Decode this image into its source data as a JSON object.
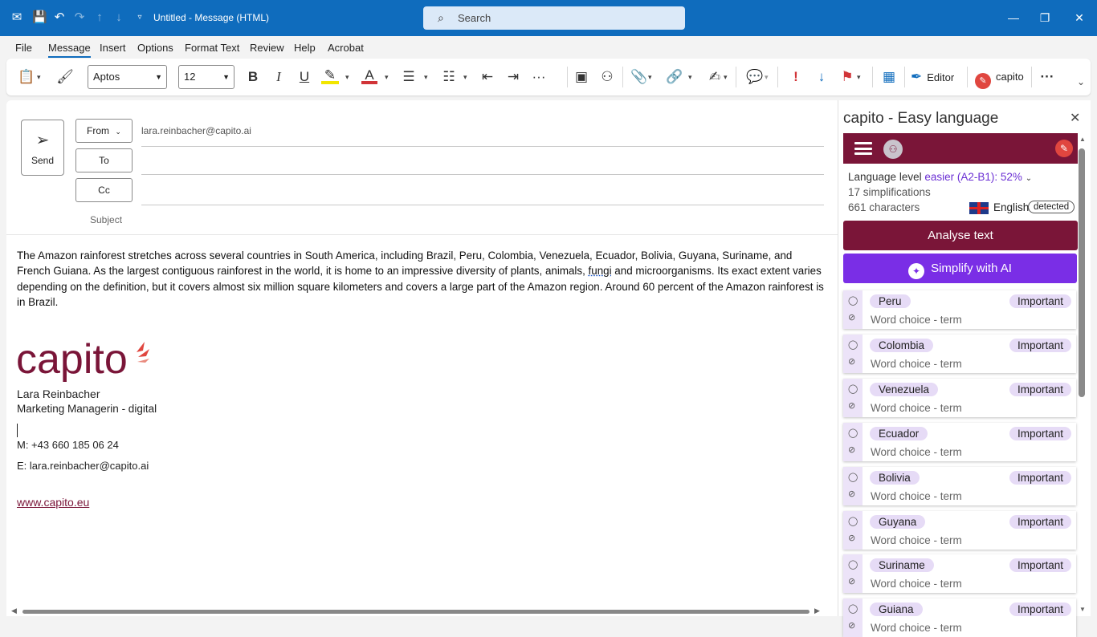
{
  "window": {
    "title": "Untitled - Message (HTML)",
    "search_placeholder": "Search"
  },
  "menu": [
    "File",
    "Message",
    "Insert",
    "Options",
    "Format Text",
    "Review",
    "Help",
    "Acrobat"
  ],
  "ribbon": {
    "font_family": "Aptos",
    "font_size": "12",
    "editor_label": "Editor",
    "capito_label": "capito"
  },
  "compose": {
    "send_label": "Send",
    "from_label": "From",
    "to_label": "To",
    "cc_label": "Cc",
    "subject_label": "Subject",
    "from_email": "lara.reinbacher@capito.ai",
    "body_part1": "The Amazon rainforest stretches across several countries in South America, including Brazil, Peru, Colombia, Venezuela, Ecuador, Bolivia, Guyana, Suriname, and French Guiana. As the largest contiguous rainforest in the world, it is home to an impressive diversity of plants, animals, ",
    "body_fungi": "fungi",
    "body_part2": " and microorganisms. Its exact extent varies depending on the definition, but it covers almost six million square kilometers and covers a large part of the Amazon region. Around 60 percent of the Amazon rainforest is in Brazil.",
    "logo_text": "capito",
    "sig_name": "Lara Reinbacher",
    "sig_role": "Marketing Managerin - digital",
    "sig_phone": "M: +43 660 185 06 24",
    "sig_email": "E:  lara.reinbacher@capito.ai",
    "sig_web": "www.capito.eu"
  },
  "pane": {
    "title": "capito - Easy language",
    "language_level_label": "Language level",
    "language_level_value": "easier (A2-B1): 52%",
    "simplifications": "17 simplifications",
    "characters": "661 characters",
    "language": "English",
    "detected": "detected",
    "analyse_label": "Analyse text",
    "ai_label": "Simplify with AI",
    "suggestions": [
      {
        "term": "Peru",
        "severity": "Important",
        "category": "Word choice - term"
      },
      {
        "term": "Colombia",
        "severity": "Important",
        "category": "Word choice - term"
      },
      {
        "term": "Venezuela",
        "severity": "Important",
        "category": "Word choice - term"
      },
      {
        "term": "Ecuador",
        "severity": "Important",
        "category": "Word choice - term"
      },
      {
        "term": "Bolivia",
        "severity": "Important",
        "category": "Word choice - term"
      },
      {
        "term": "Guyana",
        "severity": "Important",
        "category": "Word choice - term"
      },
      {
        "term": "Suriname",
        "severity": "Important",
        "category": "Word choice - term"
      },
      {
        "term": "Guiana",
        "severity": "Important",
        "category": "Word choice - term"
      }
    ]
  },
  "colors": {
    "titlebar": "#0f6cbd",
    "capito_brand": "#7a1538",
    "ai_purple": "#7a2ee6"
  }
}
